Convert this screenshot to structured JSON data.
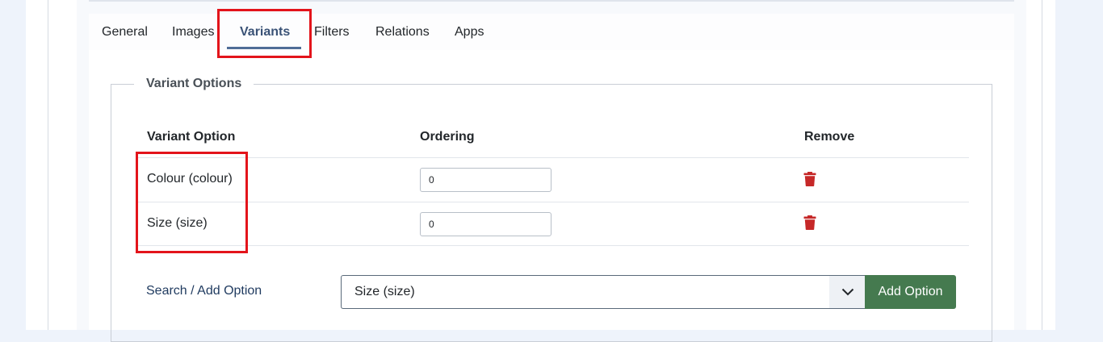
{
  "tabs": [
    {
      "label": "General"
    },
    {
      "label": "Images"
    },
    {
      "label": "Variants"
    },
    {
      "label": "Filters"
    },
    {
      "label": "Relations"
    },
    {
      "label": "Apps"
    }
  ],
  "active_tab": "Variants",
  "fieldset": {
    "legend": "Variant Options"
  },
  "table": {
    "headers": {
      "option": "Variant Option",
      "ordering": "Ordering",
      "remove": "Remove"
    },
    "rows": [
      {
        "option": "Colour (colour)",
        "ordering": "0"
      },
      {
        "option": "Size (size)",
        "ordering": "0"
      }
    ]
  },
  "add_option": {
    "label": "Search / Add Option",
    "selected": "Size (size)",
    "button": "Add Option"
  },
  "colors": {
    "accent": "#4f6d97",
    "danger": "#c62828",
    "success": "#457a4f",
    "highlight": "#e3141b"
  }
}
